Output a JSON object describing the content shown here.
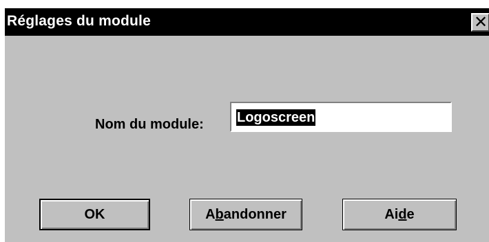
{
  "dialog": {
    "title": "Réglages du module",
    "close_glyph": "✕",
    "close_icon": "close-icon"
  },
  "form": {
    "label": "Nom du module:",
    "value": "Logoscreen",
    "value_selected": true
  },
  "buttons": {
    "ok": "OK",
    "abandon": {
      "pre": "A",
      "mnemonic": "b",
      "post": "andonner"
    },
    "help": {
      "pre": "Ai",
      "mnemonic": "d",
      "post": "e"
    }
  },
  "colors": {
    "face": "#c0c0c0",
    "titlebar": "#000000",
    "selection": "#000000",
    "field": "#ffffff"
  }
}
